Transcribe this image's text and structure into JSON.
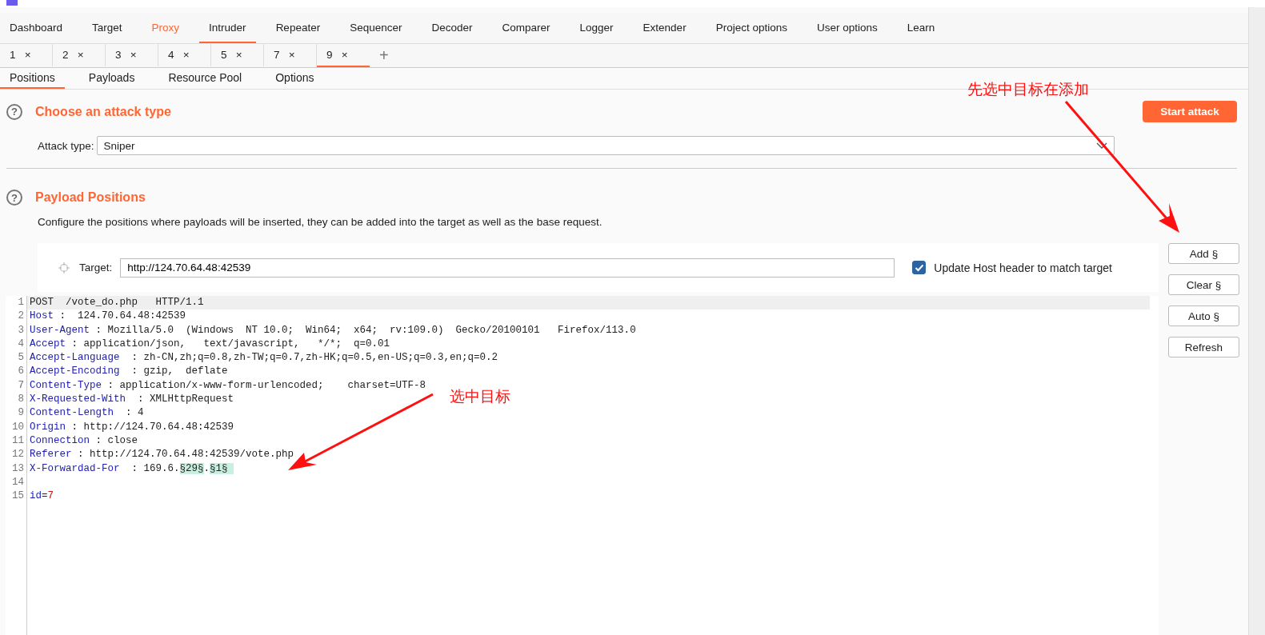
{
  "main_tabs": [
    {
      "label": "Dashboard",
      "selected": false,
      "alert": false
    },
    {
      "label": "Target",
      "selected": false,
      "alert": false
    },
    {
      "label": "Proxy",
      "selected": false,
      "alert": true
    },
    {
      "label": "Intruder",
      "selected": true,
      "alert": false
    },
    {
      "label": "Repeater",
      "selected": false,
      "alert": false
    },
    {
      "label": "Sequencer",
      "selected": false,
      "alert": false
    },
    {
      "label": "Decoder",
      "selected": false,
      "alert": false
    },
    {
      "label": "Comparer",
      "selected": false,
      "alert": false
    },
    {
      "label": "Logger",
      "selected": false,
      "alert": false
    },
    {
      "label": "Extender",
      "selected": false,
      "alert": false
    },
    {
      "label": "Project options",
      "selected": false,
      "alert": false
    },
    {
      "label": "User options",
      "selected": false,
      "alert": false
    },
    {
      "label": "Learn",
      "selected": false,
      "alert": false
    }
  ],
  "attack_tabs": [
    {
      "label": "1",
      "close": "×",
      "selected": false
    },
    {
      "label": "2",
      "close": "×",
      "selected": false
    },
    {
      "label": "3",
      "close": "×",
      "selected": false
    },
    {
      "label": "4",
      "close": "×",
      "selected": false
    },
    {
      "label": "5",
      "close": "×",
      "selected": false
    },
    {
      "label": "7",
      "close": "×",
      "selected": false
    },
    {
      "label": "9",
      "close": "×",
      "selected": true
    }
  ],
  "new_tab": "+",
  "sub_tabs": [
    {
      "label": "Positions",
      "selected": true
    },
    {
      "label": "Payloads",
      "selected": false
    },
    {
      "label": "Resource Pool",
      "selected": false
    },
    {
      "label": "Options",
      "selected": false
    }
  ],
  "attack_type_section": {
    "help": "?",
    "title": "Choose an attack type",
    "label": "Attack type:",
    "value": "Sniper",
    "start_button": "Start attack"
  },
  "positions_section": {
    "help": "?",
    "title": "Payload Positions",
    "description": "Configure the positions where payloads will be inserted, they can be added into the target as well as the base request.",
    "target_label": "Target:",
    "target_value": "http://124.70.64.48:42539",
    "update_host": {
      "label": "Update Host header to match target",
      "checked": true
    },
    "buttons": [
      "Add §",
      "Clear §",
      "Auto §",
      "Refresh"
    ]
  },
  "request_lines": [
    {
      "number": "1",
      "current": true,
      "parts": [
        {
          "kind": "plain",
          "text": "POST  /vote_do.php   HTTP/1.1"
        }
      ]
    },
    {
      "number": "2",
      "current": false,
      "parts": [
        {
          "kind": "name",
          "text": "Host"
        },
        {
          "kind": "plain",
          "text": " :  124.70.64.48:42539"
        }
      ]
    },
    {
      "number": "3",
      "current": false,
      "parts": [
        {
          "kind": "name",
          "text": "User-Agent"
        },
        {
          "kind": "plain",
          "text": " : Mozilla/5.0  (Windows  NT 10.0;  Win64;  x64;  rv:109.0)  Gecko/20100101   Firefox/113.0"
        }
      ]
    },
    {
      "number": "4",
      "current": false,
      "parts": [
        {
          "kind": "name",
          "text": "Accept"
        },
        {
          "kind": "plain",
          "text": " : application/json,   text/javascript,   */*;  q=0.01"
        }
      ]
    },
    {
      "number": "5",
      "current": false,
      "parts": [
        {
          "kind": "name",
          "text": "Accept-Language"
        },
        {
          "kind": "plain",
          "text": "  : zh-CN,zh;q=0.8,zh-TW;q=0.7,zh-HK;q=0.5,en-US;q=0.3,en;q=0.2"
        }
      ]
    },
    {
      "number": "6",
      "current": false,
      "parts": [
        {
          "kind": "name",
          "text": "Accept-Encoding"
        },
        {
          "kind": "plain",
          "text": "  : gzip,  deflate"
        }
      ]
    },
    {
      "number": "7",
      "current": false,
      "parts": [
        {
          "kind": "name",
          "text": "Content-Type"
        },
        {
          "kind": "plain",
          "text": " : application/x-www-form-urlencoded;    charset=UTF-8"
        }
      ]
    },
    {
      "number": "8",
      "current": false,
      "parts": [
        {
          "kind": "name",
          "text": "X-Requested-With"
        },
        {
          "kind": "plain",
          "text": "  : XMLHttpRequest"
        }
      ]
    },
    {
      "number": "9",
      "current": false,
      "parts": [
        {
          "kind": "name",
          "text": "Content-Length"
        },
        {
          "kind": "plain",
          "text": "  : 4"
        }
      ]
    },
    {
      "number": "10",
      "current": false,
      "parts": [
        {
          "kind": "name",
          "text": "Origin"
        },
        {
          "kind": "plain",
          "text": " : http://124.70.64.48:42539"
        }
      ]
    },
    {
      "number": "11",
      "current": false,
      "parts": [
        {
          "kind": "name",
          "text": "Connection"
        },
        {
          "kind": "plain",
          "text": " : close"
        }
      ]
    },
    {
      "number": "12",
      "current": false,
      "parts": [
        {
          "kind": "name",
          "text": "Referer"
        },
        {
          "kind": "plain",
          "text": " : http://124.70.64.48:42539/vote.php"
        }
      ]
    },
    {
      "number": "13",
      "current": false,
      "parts": [
        {
          "kind": "name",
          "text": "X-Forwardad-For"
        },
        {
          "kind": "plain",
          "text": "  : 169.6."
        },
        {
          "kind": "marker",
          "text": "§29§"
        },
        {
          "kind": "plain",
          "text": "."
        },
        {
          "kind": "marker",
          "text": "§1§ "
        }
      ]
    },
    {
      "number": "14",
      "current": false
    },
    {
      "number": "15",
      "current": false,
      "parts": [
        {
          "kind": "name",
          "text": "id"
        },
        {
          "kind": "plain",
          "text": "="
        },
        {
          "kind": "param",
          "text": "7"
        }
      ]
    }
  ],
  "annotations": [
    {
      "text": "先选中目标在添加"
    },
    {
      "text": "选中目标"
    }
  ]
}
